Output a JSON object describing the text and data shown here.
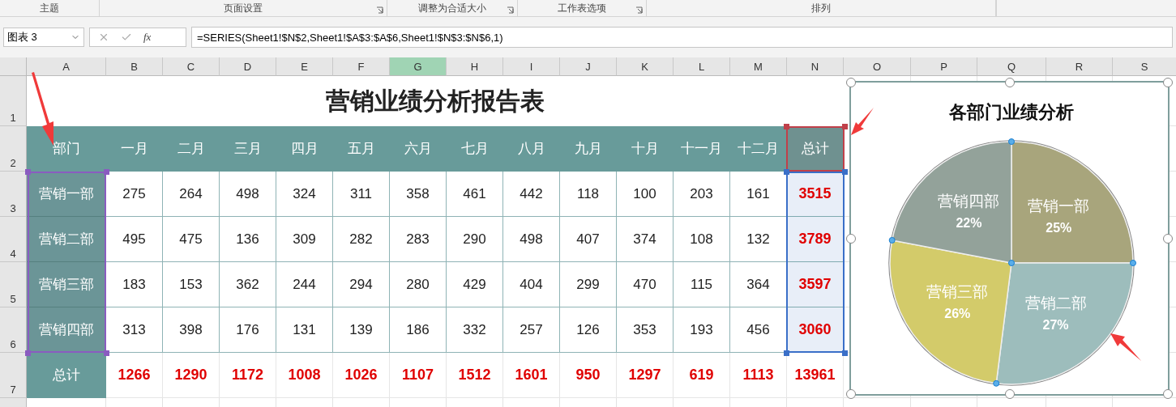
{
  "ribbon_groups": [
    {
      "label": "主题",
      "launcher": false
    },
    {
      "label": "页面设置",
      "launcher": true
    },
    {
      "label": "调整为合适大小",
      "launcher": true
    },
    {
      "label": "工作表选项",
      "launcher": true
    },
    {
      "label": "排列",
      "launcher": false
    }
  ],
  "name_box": "图表 3",
  "function_label": "fx",
  "formula": "=SERIES(Sheet1!$N$2,Sheet1!$A$3:$A$6,Sheet1!$N$3:$N$6,1)",
  "columns": [
    {
      "label": "A",
      "selected": false
    },
    {
      "label": "B",
      "selected": false
    },
    {
      "label": "C",
      "selected": false
    },
    {
      "label": "D",
      "selected": false
    },
    {
      "label": "E",
      "selected": false
    },
    {
      "label": "F",
      "selected": false
    },
    {
      "label": "G",
      "selected": true
    },
    {
      "label": "H",
      "selected": false
    },
    {
      "label": "I",
      "selected": false
    },
    {
      "label": "J",
      "selected": false
    },
    {
      "label": "K",
      "selected": false
    },
    {
      "label": "L",
      "selected": false
    },
    {
      "label": "M",
      "selected": false
    },
    {
      "label": "N",
      "selected": false
    },
    {
      "label": "O",
      "selected": false
    },
    {
      "label": "P",
      "selected": false
    },
    {
      "label": "Q",
      "selected": false
    },
    {
      "label": "R",
      "selected": false
    },
    {
      "label": "S",
      "selected": false
    }
  ],
  "row_numbers": [
    "1",
    "2",
    "3",
    "4",
    "5",
    "6",
    "7"
  ],
  "title": "营销业绩分析报告表",
  "header": [
    "部门",
    "一月",
    "二月",
    "三月",
    "四月",
    "五月",
    "六月",
    "七月",
    "八月",
    "九月",
    "十月",
    "十一月",
    "十二月",
    "总计"
  ],
  "rows": [
    [
      "营销一部",
      "275",
      "264",
      "498",
      "324",
      "311",
      "358",
      "461",
      "442",
      "118",
      "100",
      "203",
      "161",
      "3515"
    ],
    [
      "营销二部",
      "495",
      "475",
      "136",
      "309",
      "282",
      "283",
      "290",
      "498",
      "407",
      "374",
      "108",
      "132",
      "3789"
    ],
    [
      "营销三部",
      "183",
      "153",
      "362",
      "244",
      "294",
      "280",
      "429",
      "404",
      "299",
      "470",
      "115",
      "364",
      "3597"
    ],
    [
      "营销四部",
      "313",
      "398",
      "176",
      "131",
      "139",
      "186",
      "332",
      "257",
      "126",
      "353",
      "193",
      "456",
      "3060"
    ]
  ],
  "total_row": [
    "总计",
    "1266",
    "1290",
    "1172",
    "1008",
    "1026",
    "1107",
    "1512",
    "1601",
    "950",
    "1297",
    "619",
    "1113",
    "13961"
  ],
  "chart": {
    "chart_data": {
      "type": "pie",
      "title": "各部门业绩分析",
      "categories": [
        "营销一部",
        "营销二部",
        "营销三部",
        "营销四部"
      ],
      "series": [
        {
          "values": [
            25,
            27,
            26,
            22
          ]
        }
      ],
      "colors": [
        "#a8a57c",
        "#9dbdbc",
        "#d3cb6a",
        "#93a29a"
      ],
      "value_labels": [
        "25%",
        "27%",
        "26%",
        "22%"
      ]
    }
  }
}
